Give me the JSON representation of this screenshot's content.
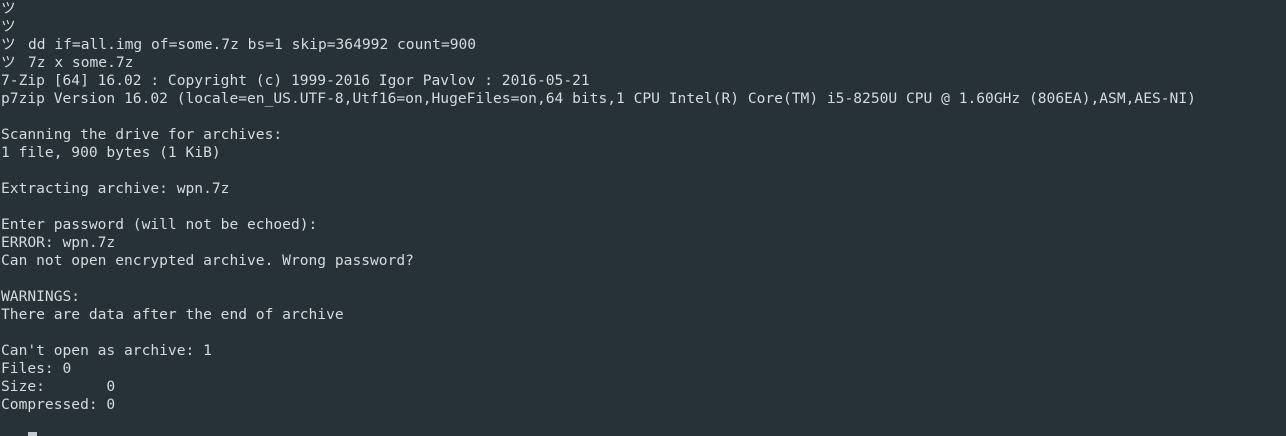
{
  "terminal": {
    "prompt_symbol": "ツ",
    "lines": [
      {
        "type": "prompt",
        "text": ""
      },
      {
        "type": "prompt",
        "text": ""
      },
      {
        "type": "prompt",
        "text": "dd if=all.img of=some.7z bs=1 skip=364992 count=900"
      },
      {
        "type": "prompt",
        "text": "7z x some.7z"
      },
      {
        "type": "output",
        "text": "7-Zip [64] 16.02 : Copyright (c) 1999-2016 Igor Pavlov : 2016-05-21"
      },
      {
        "type": "output",
        "text": "p7zip Version 16.02 (locale=en_US.UTF-8,Utf16=on,HugeFiles=on,64 bits,1 CPU Intel(R) Core(TM) i5-8250U CPU @ 1.60GHz (806EA),ASM,AES-NI)"
      },
      {
        "type": "output",
        "text": ""
      },
      {
        "type": "output",
        "text": "Scanning the drive for archives:"
      },
      {
        "type": "output",
        "text": "1 file, 900 bytes (1 KiB)"
      },
      {
        "type": "output",
        "text": ""
      },
      {
        "type": "output",
        "text": "Extracting archive: wpn.7z"
      },
      {
        "type": "output",
        "text": ""
      },
      {
        "type": "output",
        "text": "Enter password (will not be echoed):"
      },
      {
        "type": "output",
        "text": "ERROR: wpn.7z"
      },
      {
        "type": "output",
        "text": "Can not open encrypted archive. Wrong password?"
      },
      {
        "type": "output",
        "text": ""
      },
      {
        "type": "output",
        "text": "WARNINGS:"
      },
      {
        "type": "output",
        "text": "There are data after the end of archive"
      },
      {
        "type": "output",
        "text": ""
      },
      {
        "type": "output",
        "text": "Can't open as archive: 1"
      },
      {
        "type": "output",
        "text": "Files: 0"
      },
      {
        "type": "output",
        "text": "Size:       0"
      },
      {
        "type": "output",
        "text": "Compressed: 0"
      }
    ]
  },
  "colors": {
    "background": "#263238",
    "foreground": "#d4dadd",
    "cursor": "#c5ccd0"
  }
}
